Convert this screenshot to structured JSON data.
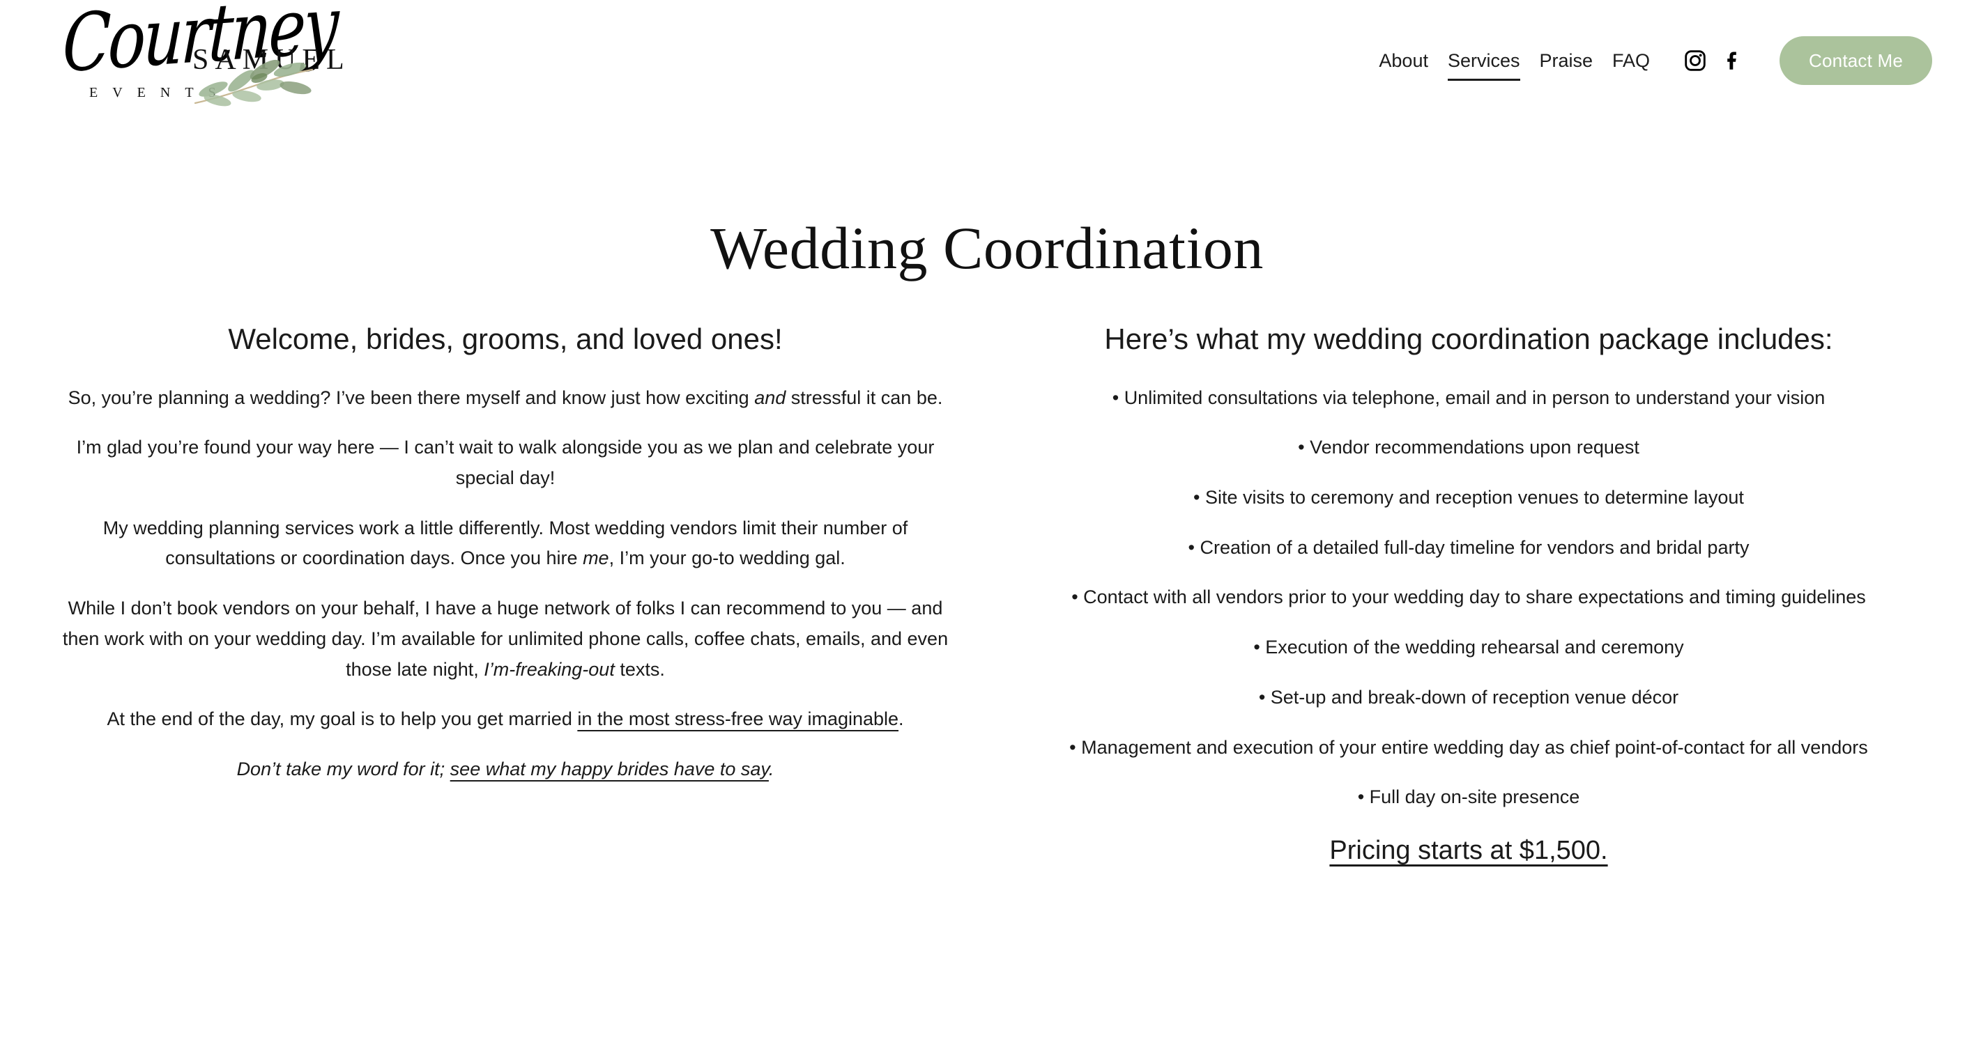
{
  "brand": {
    "script_name": "Courtney",
    "last_name": "SAMUEL",
    "tagline": "EVENTS",
    "leaf_icon": "olive-branch-icon",
    "leaf_color": "#9cb594",
    "leaf_color_dark": "#8a9f7c",
    "stem_color": "#c9b894"
  },
  "nav": {
    "items": [
      {
        "label": "About",
        "active": false
      },
      {
        "label": "Services",
        "active": true
      },
      {
        "label": "Praise",
        "active": false
      },
      {
        "label": "FAQ",
        "active": false
      }
    ],
    "social": [
      {
        "icon": "instagram-icon",
        "label": "Instagram"
      },
      {
        "icon": "facebook-icon",
        "label": "Facebook"
      }
    ],
    "cta_label": "Contact Me",
    "cta_color": "#abc39c"
  },
  "page": {
    "title": "Wedding Coordination"
  },
  "left_column": {
    "heading": "Welcome, brides, grooms, and loved ones!",
    "paragraphs": [
      {
        "id": "p1",
        "parts": [
          {
            "text": "So, you’re planning a wedding? I’ve been there myself and know just how exciting ",
            "style": "normal"
          },
          {
            "text": "and",
            "style": "italic"
          },
          {
            "text": " stressful it can be.",
            "style": "normal"
          }
        ]
      },
      {
        "id": "p2",
        "parts": [
          {
            "text": "I’m glad you’re found your way here — I can’t wait to walk alongside you as we plan and celebrate your special day!",
            "style": "normal"
          }
        ]
      },
      {
        "id": "p3",
        "parts": [
          {
            "text": "My wedding planning services work a little differently. Most wedding vendors limit their number of consultations or coordination days. Once you hire ",
            "style": "normal"
          },
          {
            "text": "me",
            "style": "italic"
          },
          {
            "text": ", I’m your go-to wedding gal.",
            "style": "normal"
          }
        ]
      },
      {
        "id": "p4",
        "parts": [
          {
            "text": "While I don’t book vendors on your behalf, I have a huge network of folks I can recommend to you — and then work with on your wedding day. I’m available for unlimited phone calls, coffee chats, emails, and even those late night, ",
            "style": "normal"
          },
          {
            "text": "I’m-freaking-out",
            "style": "italic"
          },
          {
            "text": " texts.",
            "style": "normal"
          }
        ]
      },
      {
        "id": "p5",
        "parts": [
          {
            "text": "At the end of the day, my goal is to help you get married ",
            "style": "normal"
          },
          {
            "text": "in the most stress-free way imaginable",
            "style": "link"
          },
          {
            "text": ".",
            "style": "normal"
          }
        ]
      },
      {
        "id": "p6",
        "italic_all": true,
        "parts": [
          {
            "text": "Don’t take my word for it; ",
            "style": "normal"
          },
          {
            "text": "see what my happy brides have to say",
            "style": "link"
          },
          {
            "text": ".",
            "style": "normal"
          }
        ]
      }
    ]
  },
  "right_column": {
    "heading": "Here’s what my wedding coordination package includes:",
    "items": [
      "Unlimited consultations via telephone, email and in person to understand your vision",
      "Vendor recommendations upon request",
      "Site visits to ceremony and reception venues to determine layout",
      "Creation of a detailed full-day timeline for vendors and bridal party",
      "Contact with all vendors prior to your wedding day to share expectations and timing guidelines",
      "Execution of the wedding rehearsal and ceremony",
      "Set-up and break-down of reception venue décor",
      "Management and execution of your entire wedding day as chief point-of-contact for all vendors",
      "Full day on-site presence"
    ],
    "pricing": "Pricing starts at $1,500."
  }
}
